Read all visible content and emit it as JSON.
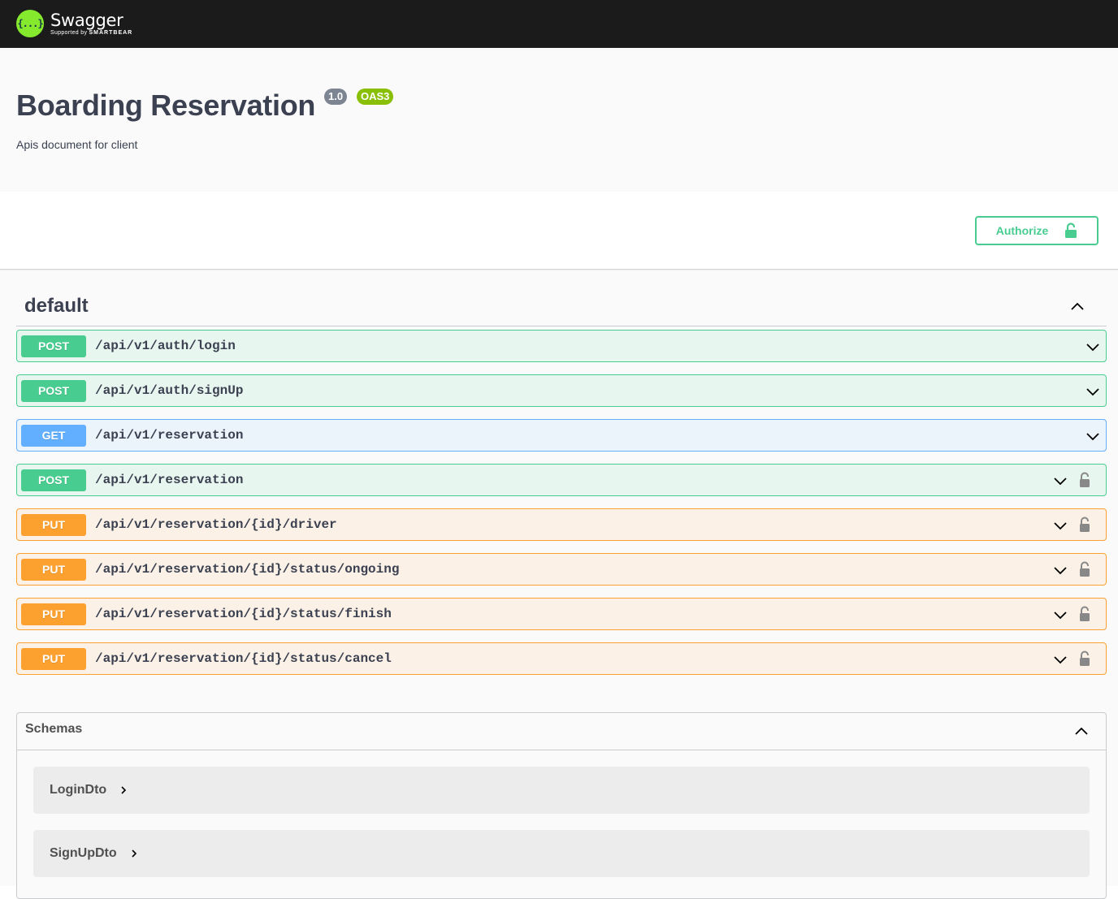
{
  "topbar": {
    "logo_glyph": "{...}",
    "brand": "Swagger",
    "supported_by": "Supported by",
    "smartbear": "SMARTBEAR"
  },
  "info": {
    "title": "Boarding Reservation",
    "version": "1.0",
    "oas": "OAS3",
    "description": "Apis document for client"
  },
  "authorize": {
    "label": "Authorize"
  },
  "tag": {
    "name": "default"
  },
  "operations": [
    {
      "method": "POST",
      "path": "/api/v1/auth/login",
      "locked": false
    },
    {
      "method": "POST",
      "path": "/api/v1/auth/signUp",
      "locked": false
    },
    {
      "method": "GET",
      "path": "/api/v1/reservation",
      "locked": false
    },
    {
      "method": "POST",
      "path": "/api/v1/reservation",
      "locked": true
    },
    {
      "method": "PUT",
      "path": "/api/v1/reservation/{id}/driver",
      "locked": true
    },
    {
      "method": "PUT",
      "path": "/api/v1/reservation/{id}/status/ongoing",
      "locked": true
    },
    {
      "method": "PUT",
      "path": "/api/v1/reservation/{id}/status/finish",
      "locked": true
    },
    {
      "method": "PUT",
      "path": "/api/v1/reservation/{id}/status/cancel",
      "locked": true
    }
  ],
  "schemas": {
    "title": "Schemas",
    "models": [
      "LoginDto",
      "SignUpDto"
    ]
  },
  "colors": {
    "post": "#49cc90",
    "get": "#61affe",
    "put": "#fca130",
    "brand_green": "#85ea2d"
  }
}
